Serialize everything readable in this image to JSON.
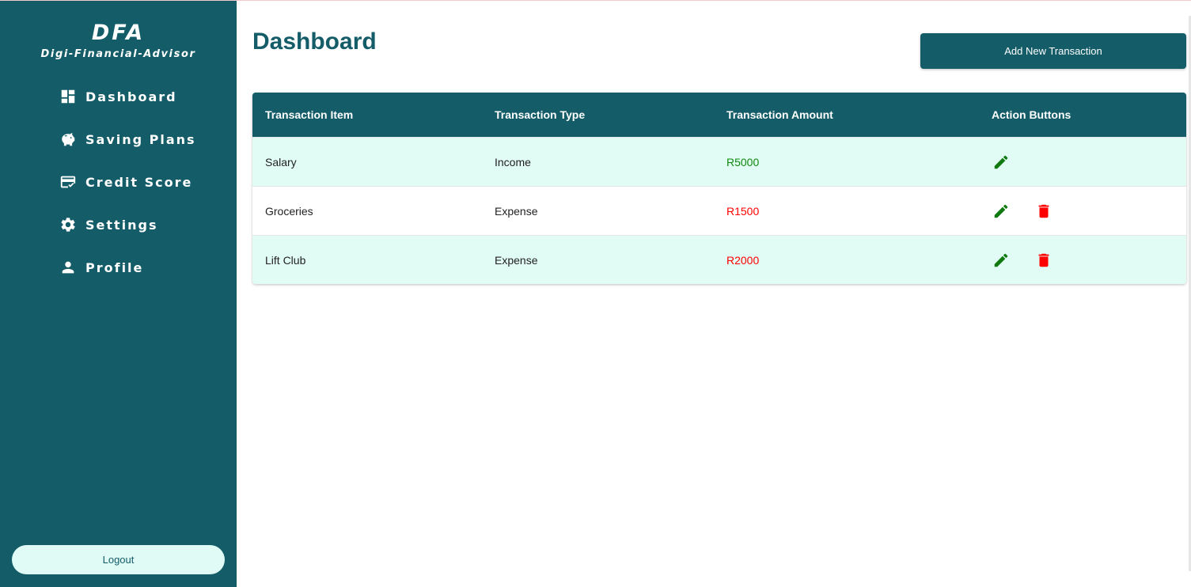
{
  "brand": {
    "title": "DFA",
    "subtitle": "Digi-Financial-Advisor"
  },
  "sidebar": {
    "items": [
      {
        "label": "Dashboard",
        "icon": "dashboard-icon"
      },
      {
        "label": "Saving Plans",
        "icon": "piggy-bank-icon"
      },
      {
        "label": "Credit Score",
        "icon": "credit-card-icon"
      },
      {
        "label": "Settings",
        "icon": "gear-icon"
      },
      {
        "label": "Profile",
        "icon": "person-icon"
      }
    ],
    "logout_label": "Logout"
  },
  "main": {
    "title": "Dashboard",
    "add_button_label": "Add New Transaction"
  },
  "table": {
    "headers": [
      "Transaction Item",
      "Transaction Type",
      "Transaction Amount",
      "Action Buttons"
    ],
    "rows": [
      {
        "item": "Salary",
        "type": "Income",
        "amount": "R5000",
        "amount_color": "#0f8a0f",
        "actions": [
          "edit"
        ]
      },
      {
        "item": "Groceries",
        "type": "Expense",
        "amount": "R1500",
        "amount_color": "#ff0000",
        "actions": [
          "edit",
          "delete"
        ]
      },
      {
        "item": "Lift Club",
        "type": "Expense",
        "amount": "R2000",
        "amount_color": "#ff0000",
        "actions": [
          "edit",
          "delete"
        ]
      }
    ]
  },
  "colors": {
    "primary": "#135c68",
    "row_highlight": "#e1fbf5",
    "edit_icon": "#0f7a0f",
    "delete_icon": "#ff0000"
  }
}
